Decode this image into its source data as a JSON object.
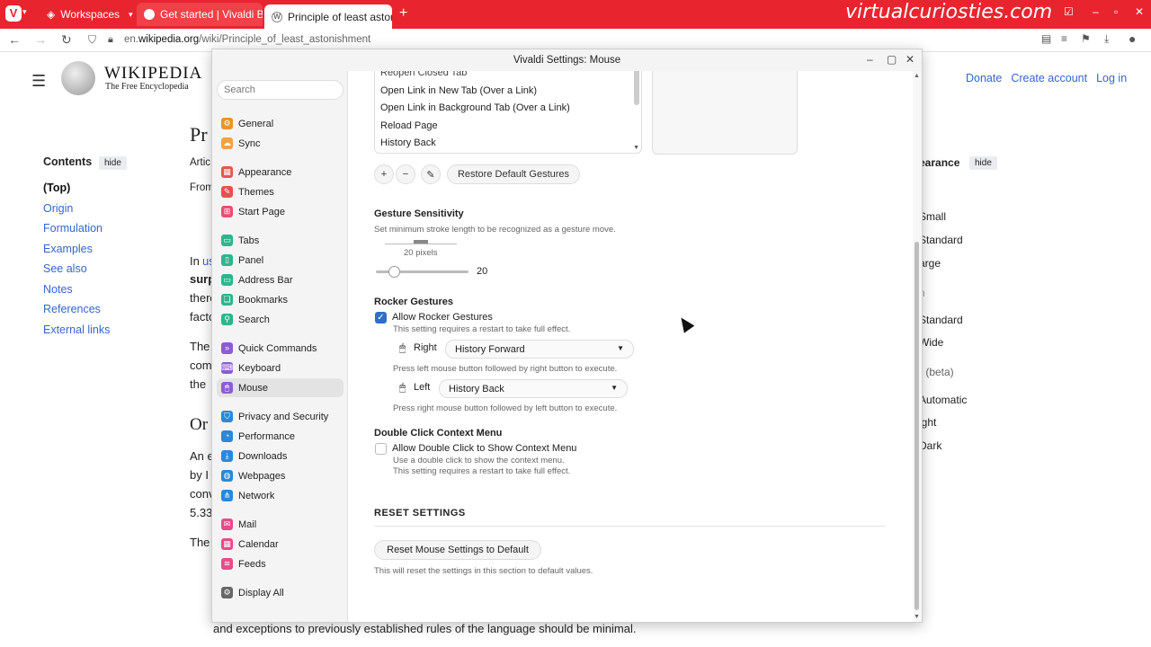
{
  "browser": {
    "workspaces_label": "Workspaces",
    "tabs": [
      {
        "title": "Get started | Vivaldi Bro..."
      },
      {
        "title": "Principle of least astonishm"
      }
    ],
    "url_prefix": "en.",
    "url_domain": "wikipedia.org",
    "url_path": "/wiki/Principle_of_least_astonishment",
    "watermark": "virtualcuriosties.com"
  },
  "wiki": {
    "title": "WIKIPEDIA",
    "subtitle": "The Free Encyclopedia",
    "links": [
      "Donate",
      "Create account",
      "Log in"
    ],
    "contents_label": "Contents",
    "hide_label": "hide",
    "toc": [
      "(Top)",
      "Origin",
      "Formulation",
      "Examples",
      "See also",
      "Notes",
      "References",
      "External links"
    ],
    "appearance_label": "earance",
    "side_options": [
      "Small",
      "Standard",
      "arge",
      "n",
      "Standard",
      "Wide",
      "r (beta)",
      "Automatic",
      "ight",
      "Dark"
    ],
    "fragments": [
      "Pr",
      "Artic",
      "From",
      "In",
      "us",
      "surp",
      "there",
      "facto",
      "The",
      "com",
      "the",
      "Or",
      "An e",
      "by I",
      "conv",
      "5.33",
      "The"
    ],
    "bottom_text": "and exceptions to previously established rules of the language should be minimal."
  },
  "settings": {
    "title": "Vivaldi Settings: Mouse",
    "search_placeholder": "Search",
    "sidebar": [
      {
        "label": "General",
        "icon": "gear-icon",
        "color": "#e8942a"
      },
      {
        "label": "Sync",
        "icon": "cloud-icon",
        "color": "#f0a24a"
      },
      {
        "label": "Appearance",
        "icon": "appearance-icon",
        "color": "#e8554e"
      },
      {
        "label": "Themes",
        "icon": "brush-icon",
        "color": "#e85050"
      },
      {
        "label": "Start Page",
        "icon": "grid-icon",
        "color": "#e85070"
      },
      {
        "label": "Tabs",
        "icon": "tabs-icon",
        "color": "#2fb58c"
      },
      {
        "label": "Panel",
        "icon": "panel-icon",
        "color": "#2fb58c"
      },
      {
        "label": "Address Bar",
        "icon": "address-bar-icon",
        "color": "#2fb58c"
      },
      {
        "label": "Bookmarks",
        "icon": "bookmark-icon",
        "color": "#2fb58c"
      },
      {
        "label": "Search",
        "icon": "search-icon",
        "color": "#2fb58c"
      },
      {
        "label": "Quick Commands",
        "icon": "quick-commands-icon",
        "color": "#8c5bd6"
      },
      {
        "label": "Keyboard",
        "icon": "keyboard-icon",
        "color": "#8c5bd6"
      },
      {
        "label": "Mouse",
        "icon": "mouse-icon",
        "color": "#8c5bd6"
      },
      {
        "label": "Privacy and Security",
        "icon": "shield-icon",
        "color": "#2a88d8"
      },
      {
        "label": "Performance",
        "icon": "gauge-icon",
        "color": "#2a88d8"
      },
      {
        "label": "Downloads",
        "icon": "download-icon",
        "color": "#2a88d8"
      },
      {
        "label": "Webpages",
        "icon": "globe-icon",
        "color": "#2a88d8"
      },
      {
        "label": "Network",
        "icon": "network-icon",
        "color": "#2a88d8"
      },
      {
        "label": "Mail",
        "icon": "mail-icon",
        "color": "#e84a8a"
      },
      {
        "label": "Calendar",
        "icon": "calendar-icon",
        "color": "#e84a8a"
      },
      {
        "label": "Feeds",
        "icon": "feeds-icon",
        "color": "#e84a8a"
      },
      {
        "label": "Display All",
        "icon": "settings-icon",
        "color": "#666666"
      }
    ],
    "gestures_list": [
      "Reopen Closed Tab",
      "Open Link in New Tab (Over a Link)",
      "Open Link in Background Tab (Over a Link)",
      "Reload Page",
      "History Back"
    ],
    "restore_default_gestures": "Restore Default Gestures",
    "gesture_sensitivity": {
      "heading": "Gesture Sensitivity",
      "description": "Set minimum stroke length to be recognized as a gesture move.",
      "preview_label": "20 pixels",
      "value": "20"
    },
    "rocker": {
      "heading": "Rocker Gestures",
      "checkbox_label": "Allow Rocker Gestures",
      "checkbox_note": "This setting requires a restart to take full effect.",
      "right_label": "Right",
      "right_value": "History Forward",
      "right_note": "Press left mouse button followed by right button to execute.",
      "left_label": "Left",
      "left_value": "History Back",
      "left_note": "Press right mouse button followed by left button to execute."
    },
    "double_click": {
      "heading": "Double Click Context Menu",
      "checkbox_label": "Allow Double Click to Show Context Menu",
      "note1": "Use a double click to show the context menu.",
      "note2": "This setting requires a restart to take full effect."
    },
    "reset": {
      "heading": "RESET SETTINGS",
      "button": "Reset Mouse Settings to Default",
      "note": "This will reset the settings in this section to default values."
    }
  }
}
